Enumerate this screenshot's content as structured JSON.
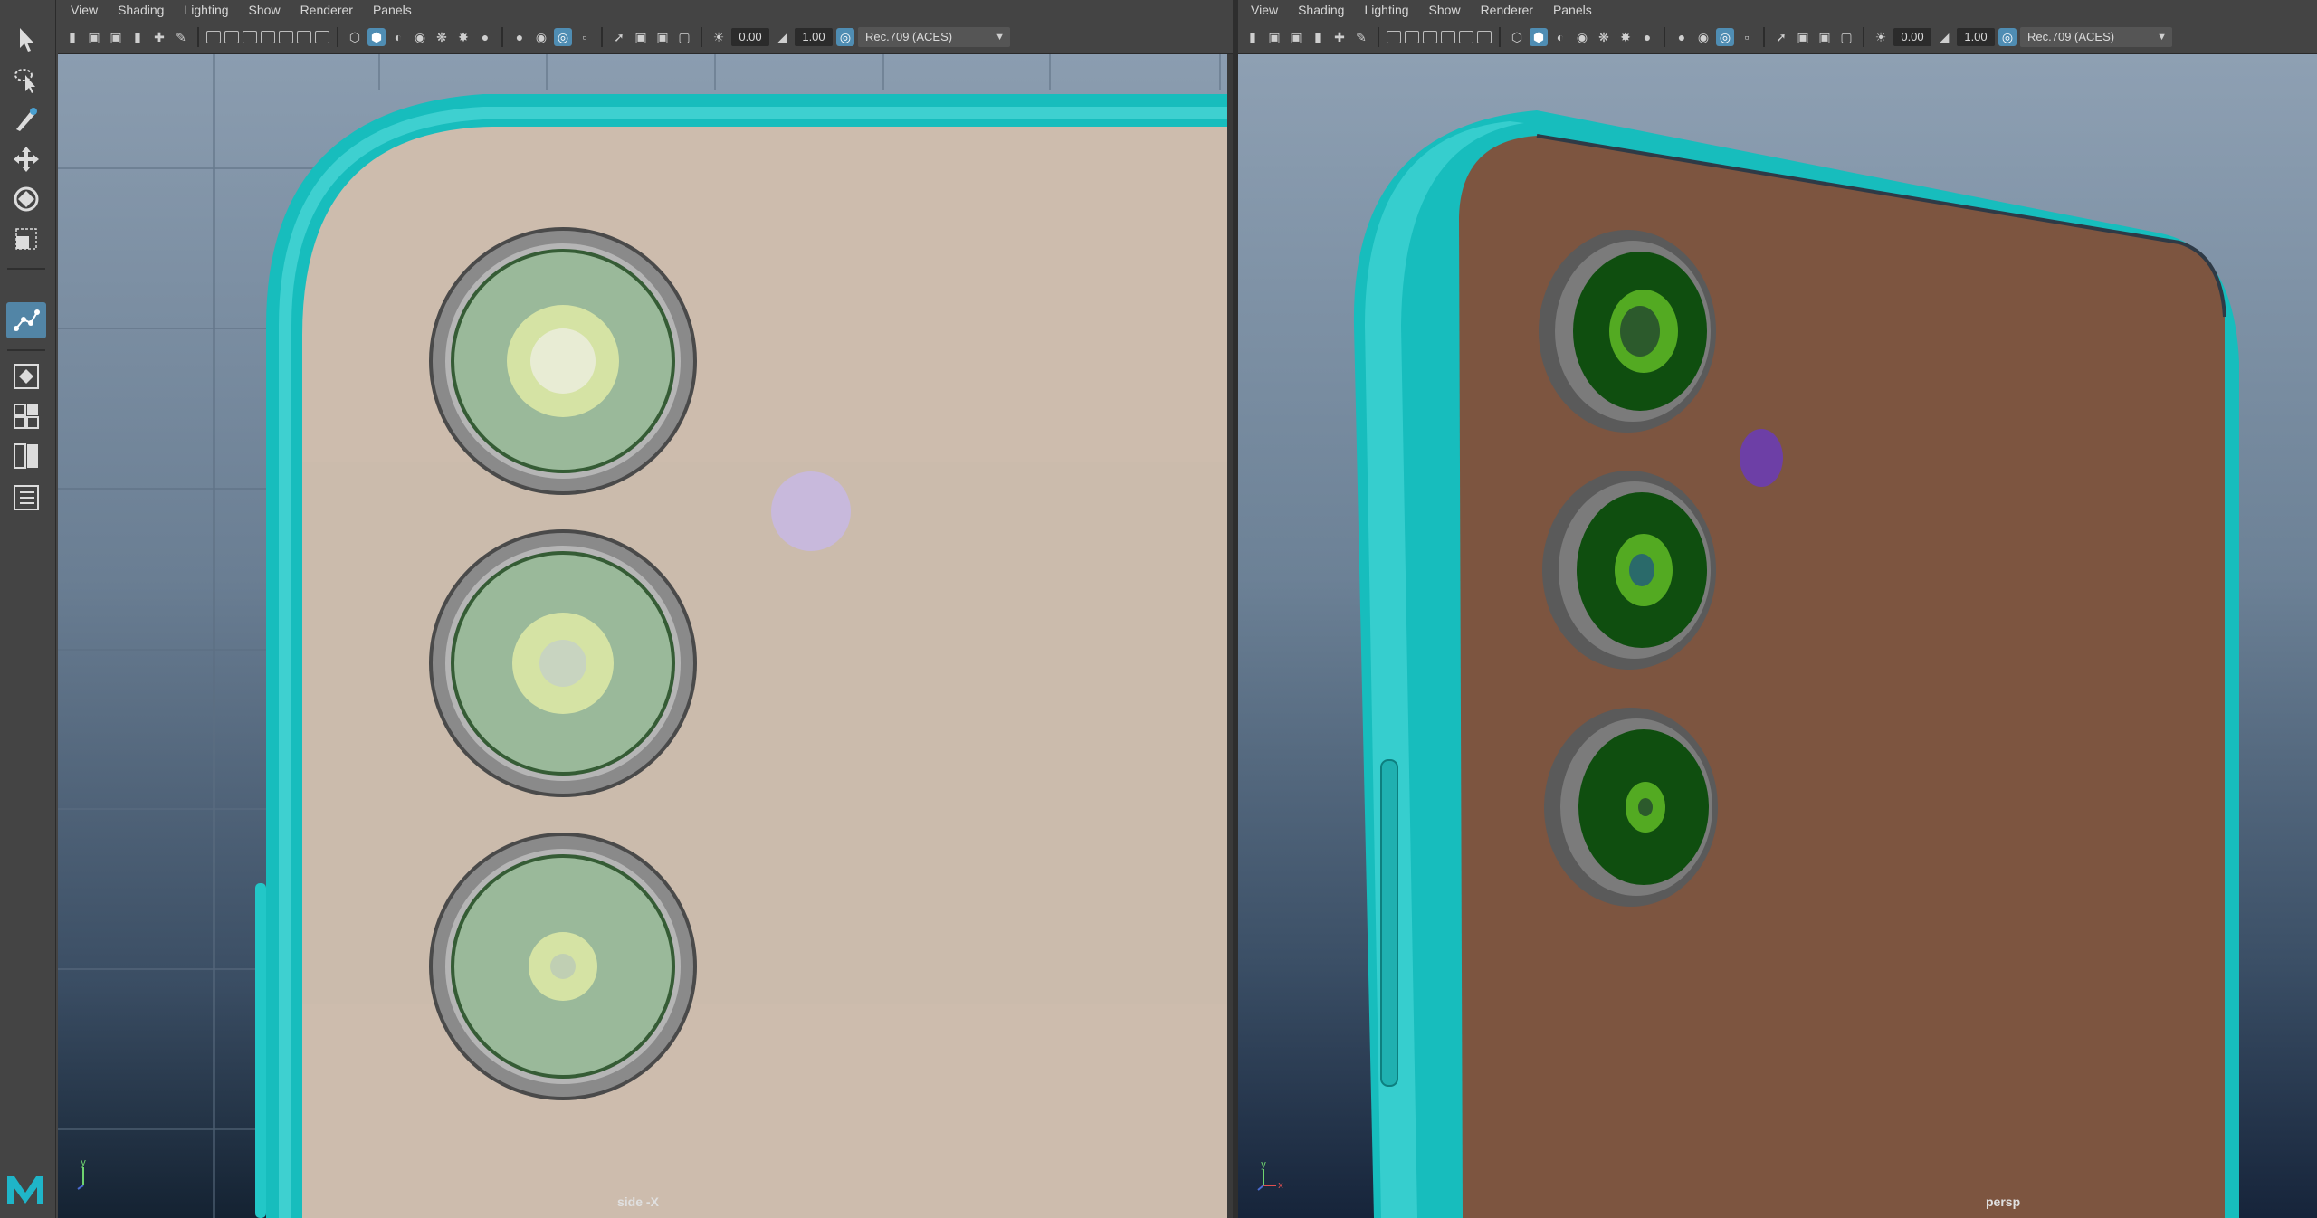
{
  "left_panel": {
    "menu": [
      "View",
      "Shading",
      "Lighting",
      "Show",
      "Renderer",
      "Panels"
    ],
    "exposure": "0.00",
    "gamma": "1.00",
    "color_space": "Rec.709 (ACES)",
    "camera_label": "side -X"
  },
  "right_panel": {
    "menu": [
      "View",
      "Shading",
      "Lighting",
      "Show",
      "Renderer",
      "Panels"
    ],
    "exposure": "0.00",
    "gamma": "1.00",
    "color_space": "Rec.709 (ACES)",
    "camera_label": "persp"
  },
  "gizmo": {
    "y": "y",
    "x": "x"
  },
  "colors": {
    "phone_frame": "#17bdbd",
    "back_left": "#cdbcad",
    "back_right": "#7d5540",
    "lens_left": "#9ab99a",
    "lens_right": "#155f15",
    "flash_left": "#c8b9dc",
    "flash_right": "#6d3fa6",
    "selection_blue": "#5285a6"
  },
  "tools": [
    "select-tool",
    "lasso-tool",
    "paint-select-tool",
    "move-tool",
    "rotate-tool",
    "scale-tool",
    "soft-select-tool",
    "quad-layout",
    "two-pane-layout",
    "outliner-layout",
    "list-layout"
  ]
}
